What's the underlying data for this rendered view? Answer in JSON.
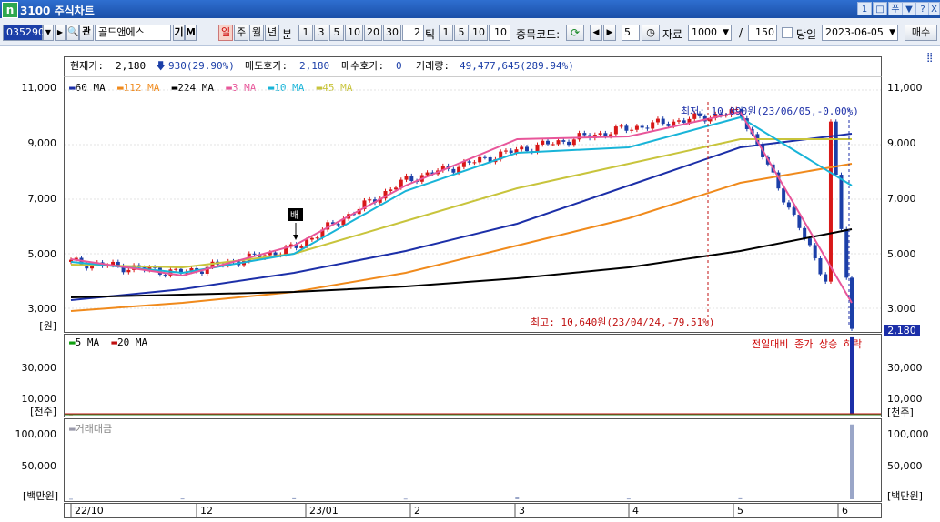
{
  "window": {
    "title": "3100 주식차트",
    "logo": "n",
    "controls": [
      "1",
      "□",
      "푸",
      "▼",
      "?",
      "X"
    ]
  },
  "toolbar": {
    "code": "035290",
    "stock_name": "골드앤에스",
    "gi": "기",
    "m": "M",
    "periods": [
      "일",
      "주",
      "월",
      "년",
      "분"
    ],
    "minute_opts": [
      "1",
      "3",
      "5",
      "10",
      "20",
      "30"
    ],
    "custom_min": "2",
    "tick_label": "틱",
    "tick_opts": [
      "1",
      "5",
      "10"
    ],
    "custom_tick": "10",
    "code_search_label": "종목코드:",
    "count": "5",
    "data_label": "자료",
    "data_count": "1000",
    "slash": "/",
    "page_size": "150",
    "today_label": "당일",
    "date": "2023-06-05",
    "trade_button": "매수"
  },
  "info": {
    "current_label": "현재가:",
    "current_value": "2,180",
    "change": "930(29.90%)",
    "ask_label": "매도호가:",
    "ask_value": "2,180",
    "bid_label": "매수호가:",
    "bid_value": "0",
    "volume_label": "거래량:",
    "volume_value": "49,477,645(289.94%)"
  },
  "price_panel": {
    "unit_left": "[원]",
    "y_ticks": [
      "11,000",
      "9,000",
      "7,000",
      "5,000",
      "3,000"
    ],
    "current_price_tag": "2,180",
    "high_annotation": "최고: 10,640원(23/04/24,-79.51%)",
    "cursor_annotation": "최저: 10,090원(23/06/05,-0.00%)",
    "event_marker": "배",
    "ma_legend": [
      {
        "label": "60 MA",
        "color": "#1c2fa8"
      },
      {
        "label": "112 MA",
        "color": "#f08a1c"
      },
      {
        "label": "224 MA",
        "color": "#000000"
      },
      {
        "label": "3 MA",
        "color": "#e8569a"
      },
      {
        "label": "10 MA",
        "color": "#18b4d8"
      },
      {
        "label": "45 MA",
        "color": "#c8c43c"
      }
    ]
  },
  "volume_panel": {
    "unit_left": "[천주]",
    "unit_right": "[천주]",
    "y_ticks": [
      "30,000",
      "10,000"
    ],
    "legend": [
      {
        "label": "5 MA",
        "color": "#10a010"
      },
      {
        "label": "20 MA",
        "color": "#c01010"
      }
    ],
    "note": "전일대비 종가 상승 하락"
  },
  "amount_panel": {
    "unit_left": "[백만원]",
    "unit_right": "[백만원]",
    "y_ticks": [
      "100,000",
      "50,000"
    ],
    "legend": "거래대금"
  },
  "x_axis": [
    "22/10",
    "12",
    "23/01",
    "2",
    "3",
    "4",
    "5",
    "6"
  ],
  "chart_data": {
    "type": "line",
    "title": "",
    "ylabel": "[원]",
    "ylim": [
      2100,
      11500
    ],
    "x": [
      "22/10",
      "12",
      "23/01",
      "2",
      "3",
      "4",
      "5",
      "6"
    ],
    "series": [
      {
        "name": "60 MA",
        "values": [
          3300,
          3700,
          4300,
          5100,
          6100,
          7500,
          8900,
          9400
        ]
      },
      {
        "name": "112 MA",
        "values": [
          2900,
          3200,
          3600,
          4300,
          5300,
          6300,
          7600,
          8300
        ]
      },
      {
        "name": "224 MA",
        "values": [
          3400,
          3500,
          3600,
          3800,
          4100,
          4500,
          5100,
          5900
        ]
      },
      {
        "name": "45 MA",
        "values": [
          4600,
          4500,
          5000,
          6200,
          7400,
          8300,
          9200,
          9200
        ]
      },
      {
        "name": "10 MA",
        "values": [
          4700,
          4300,
          5000,
          7300,
          8700,
          8900,
          10000,
          7500
        ]
      },
      {
        "name": "3 MA",
        "values": [
          4800,
          4200,
          5300,
          7500,
          9200,
          9300,
          10200,
          3200
        ]
      }
    ],
    "closes": [
      4700,
      4300,
      5200,
      7700,
      8800,
      9600,
      10200,
      2180
    ],
    "volume_thousand": [
      200,
      300,
      400,
      300,
      700,
      300,
      400,
      49477
    ],
    "amount_million": [
      800,
      1200,
      1500,
      1000,
      3000,
      1200,
      1500,
      110000
    ]
  }
}
